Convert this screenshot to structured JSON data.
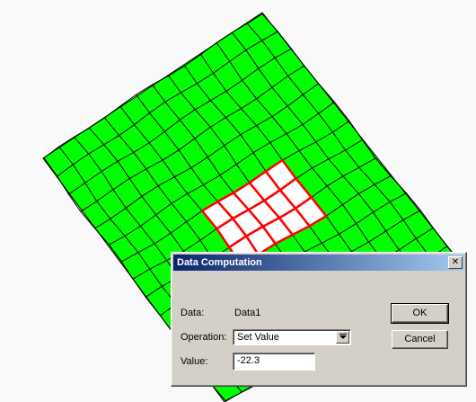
{
  "dialog": {
    "title": "Data Computation",
    "close_glyph": "✕",
    "data_label": "Data:",
    "data_value": "Data1",
    "operation_label": "Operation:",
    "operation_selected": "Set Value",
    "value_label": "Value:",
    "value_input": "-22.3",
    "ok_label": "OK",
    "cancel_label": "Cancel"
  },
  "mesh": {
    "fill_color": "#00ff00",
    "line_color": "#000000",
    "selection_color": "#ff0000",
    "selection_fill": "#ffffff"
  },
  "icons": {
    "close": "close-icon",
    "dropdown": "chevron-down-icon"
  }
}
